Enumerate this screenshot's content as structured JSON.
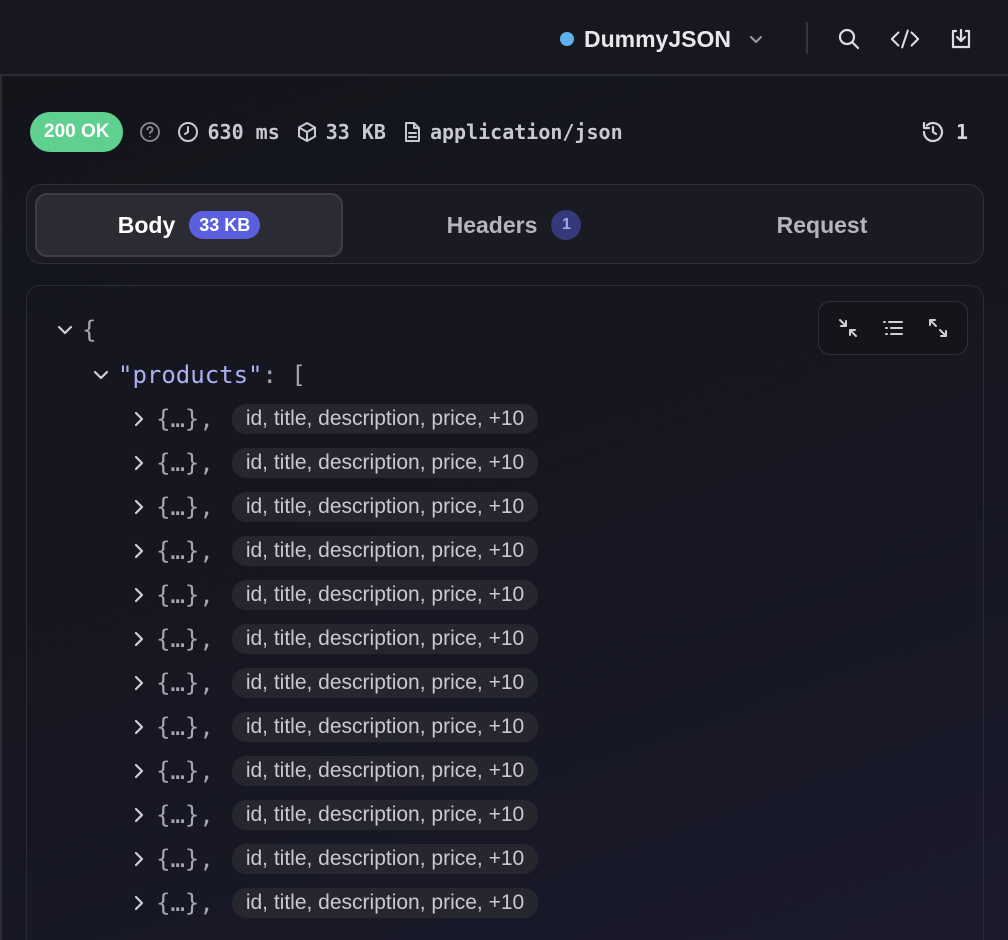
{
  "topbar": {
    "environment": "DummyJSON",
    "environment_color": "#5fb1ee",
    "icons": [
      "chevron-down-icon",
      "search-icon",
      "code-icon",
      "download-icon"
    ]
  },
  "response": {
    "status": "200 OK",
    "status_color": "#5fd08f",
    "time": "630 ms",
    "size": "33 KB",
    "content_type": "application/json",
    "history_count": "1"
  },
  "tabs": [
    {
      "label": "Body",
      "badge": "33 KB"
    },
    {
      "label": "Headers",
      "badge": "1"
    },
    {
      "label": "Request"
    }
  ],
  "json_view": {
    "root_open": "{",
    "products_key": "\"products\"",
    "colon": ":",
    "array_open": "[",
    "collapsed_object": "{…}",
    "comma": ",",
    "item_summary": "id, title, description, price, +10",
    "visible_items": 12
  }
}
